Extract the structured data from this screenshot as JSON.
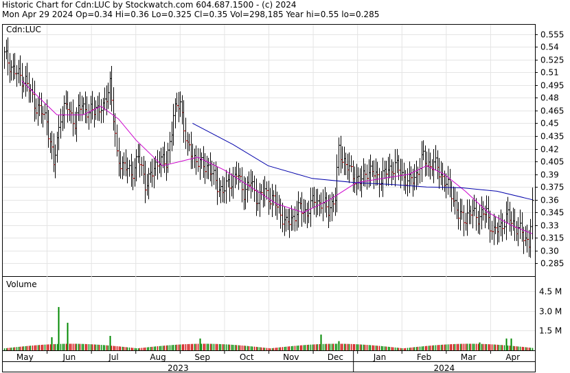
{
  "header": {
    "line1": "Historic Chart for Cdn:LUC by Stockwatch.com 604.687.1500 - (c) 2024",
    "line2": "Mon Apr 29 2024  Op=0.34  Hi=0.36  Lo=0.325  Cl=0.35  Vol=298,185  Year hi=0.55  lo=0.285"
  },
  "chart_data": {
    "type": "ohlc",
    "price_panel_label": "Cdn:LUC",
    "volume_panel_label": "Volume",
    "y_ticks": [
      0.285,
      0.3,
      0.315,
      0.33,
      0.345,
      0.36,
      0.375,
      0.39,
      0.405,
      0.42,
      0.435,
      0.45,
      0.465,
      0.48,
      0.495,
      0.51,
      0.525,
      0.54,
      0.555
    ],
    "y_tick_labels": [
      "0.285",
      "0.30",
      "0.315",
      "0.33",
      "0.345",
      "0.36",
      "0.375",
      "0.39",
      "0.405",
      "0.42",
      "0.435",
      "0.45",
      "0.465",
      "0.48",
      "0.495",
      "0.51",
      "0.525",
      "0.54",
      "0.555"
    ],
    "ylim": [
      0.27,
      0.566
    ],
    "volume_ticks": [
      1.5,
      3.0,
      4.5
    ],
    "volume_tick_labels": [
      "1.5 M",
      "3.0 M",
      "4.5 M"
    ],
    "volume_ylim": [
      0,
      5.6
    ],
    "months": [
      "May",
      "Jun",
      "Jul",
      "Aug",
      "Sep",
      "Oct",
      "Nov",
      "Dec",
      "Jan",
      "Feb",
      "Mar",
      "Apr"
    ],
    "years": [
      "2023",
      "2024"
    ],
    "grid": true,
    "series_colors": {
      "bars": "#000000",
      "down_tick": "#cc0000",
      "ma_short": "#cc00cc",
      "ma_long": "#0000aa",
      "vol_up": "#008800",
      "vol_down": "#cc0000"
    },
    "close_trend": [
      [
        0,
        0.53
      ],
      [
        6,
        0.51
      ],
      [
        12,
        0.5
      ],
      [
        18,
        0.47
      ],
      [
        24,
        0.455
      ],
      [
        28,
        0.4
      ],
      [
        32,
        0.46
      ],
      [
        36,
        0.47
      ],
      [
        40,
        0.45
      ],
      [
        44,
        0.475
      ],
      [
        48,
        0.46
      ],
      [
        52,
        0.47
      ],
      [
        56,
        0.465
      ],
      [
        60,
        0.5
      ],
      [
        64,
        0.41
      ],
      [
        68,
        0.4
      ],
      [
        72,
        0.39
      ],
      [
        76,
        0.41
      ],
      [
        80,
        0.38
      ],
      [
        84,
        0.39
      ],
      [
        88,
        0.41
      ],
      [
        92,
        0.4
      ],
      [
        96,
        0.46
      ],
      [
        100,
        0.475
      ],
      [
        104,
        0.42
      ],
      [
        108,
        0.41
      ],
      [
        112,
        0.4
      ],
      [
        116,
        0.4
      ],
      [
        120,
        0.38
      ],
      [
        124,
        0.37
      ],
      [
        128,
        0.38
      ],
      [
        132,
        0.39
      ],
      [
        136,
        0.37
      ],
      [
        140,
        0.38
      ],
      [
        144,
        0.36
      ],
      [
        148,
        0.37
      ],
      [
        152,
        0.36
      ],
      [
        156,
        0.35
      ],
      [
        160,
        0.33
      ],
      [
        164,
        0.34
      ],
      [
        168,
        0.35
      ],
      [
        172,
        0.345
      ],
      [
        176,
        0.36
      ],
      [
        180,
        0.355
      ],
      [
        184,
        0.35
      ],
      [
        188,
        0.36
      ],
      [
        190,
        0.42
      ],
      [
        194,
        0.4
      ],
      [
        198,
        0.39
      ],
      [
        202,
        0.38
      ],
      [
        206,
        0.395
      ],
      [
        210,
        0.39
      ],
      [
        214,
        0.385
      ],
      [
        218,
        0.395
      ],
      [
        222,
        0.4
      ],
      [
        226,
        0.39
      ],
      [
        230,
        0.38
      ],
      [
        234,
        0.39
      ],
      [
        238,
        0.41
      ],
      [
        242,
        0.4
      ],
      [
        246,
        0.4
      ],
      [
        250,
        0.38
      ],
      [
        254,
        0.37
      ],
      [
        258,
        0.34
      ],
      [
        262,
        0.34
      ],
      [
        266,
        0.345
      ],
      [
        270,
        0.34
      ],
      [
        274,
        0.345
      ],
      [
        278,
        0.32
      ],
      [
        282,
        0.33
      ],
      [
        286,
        0.34
      ],
      [
        290,
        0.33
      ],
      [
        294,
        0.32
      ],
      [
        298,
        0.31
      ],
      [
        300,
        0.35
      ]
    ],
    "ma_short": [
      [
        10,
        0.5
      ],
      [
        30,
        0.46
      ],
      [
        45,
        0.46
      ],
      [
        55,
        0.47
      ],
      [
        65,
        0.455
      ],
      [
        75,
        0.43
      ],
      [
        90,
        0.4
      ],
      [
        100,
        0.405
      ],
      [
        110,
        0.41
      ],
      [
        125,
        0.395
      ],
      [
        140,
        0.375
      ],
      [
        155,
        0.355
      ],
      [
        170,
        0.345
      ],
      [
        185,
        0.36
      ],
      [
        200,
        0.38
      ],
      [
        215,
        0.385
      ],
      [
        230,
        0.39
      ],
      [
        240,
        0.4
      ],
      [
        250,
        0.39
      ],
      [
        262,
        0.37
      ],
      [
        275,
        0.345
      ],
      [
        288,
        0.33
      ],
      [
        300,
        0.32
      ]
    ],
    "ma_long": [
      [
        107,
        0.45
      ],
      [
        130,
        0.425
      ],
      [
        150,
        0.4
      ],
      [
        175,
        0.385
      ],
      [
        200,
        0.38
      ],
      [
        220,
        0.378
      ],
      [
        240,
        0.375
      ],
      [
        260,
        0.374
      ],
      [
        280,
        0.37
      ],
      [
        300,
        0.36
      ]
    ],
    "volume_bars_m": [
      [
        27,
        1.0
      ],
      [
        31,
        3.3
      ],
      [
        36,
        2.1
      ],
      [
        60,
        1.1
      ],
      [
        111,
        0.9
      ],
      [
        180,
        1.2
      ],
      [
        190,
        0.7
      ],
      [
        270,
        0.6
      ],
      [
        285,
        0.9
      ],
      [
        288,
        0.9
      ]
    ]
  }
}
